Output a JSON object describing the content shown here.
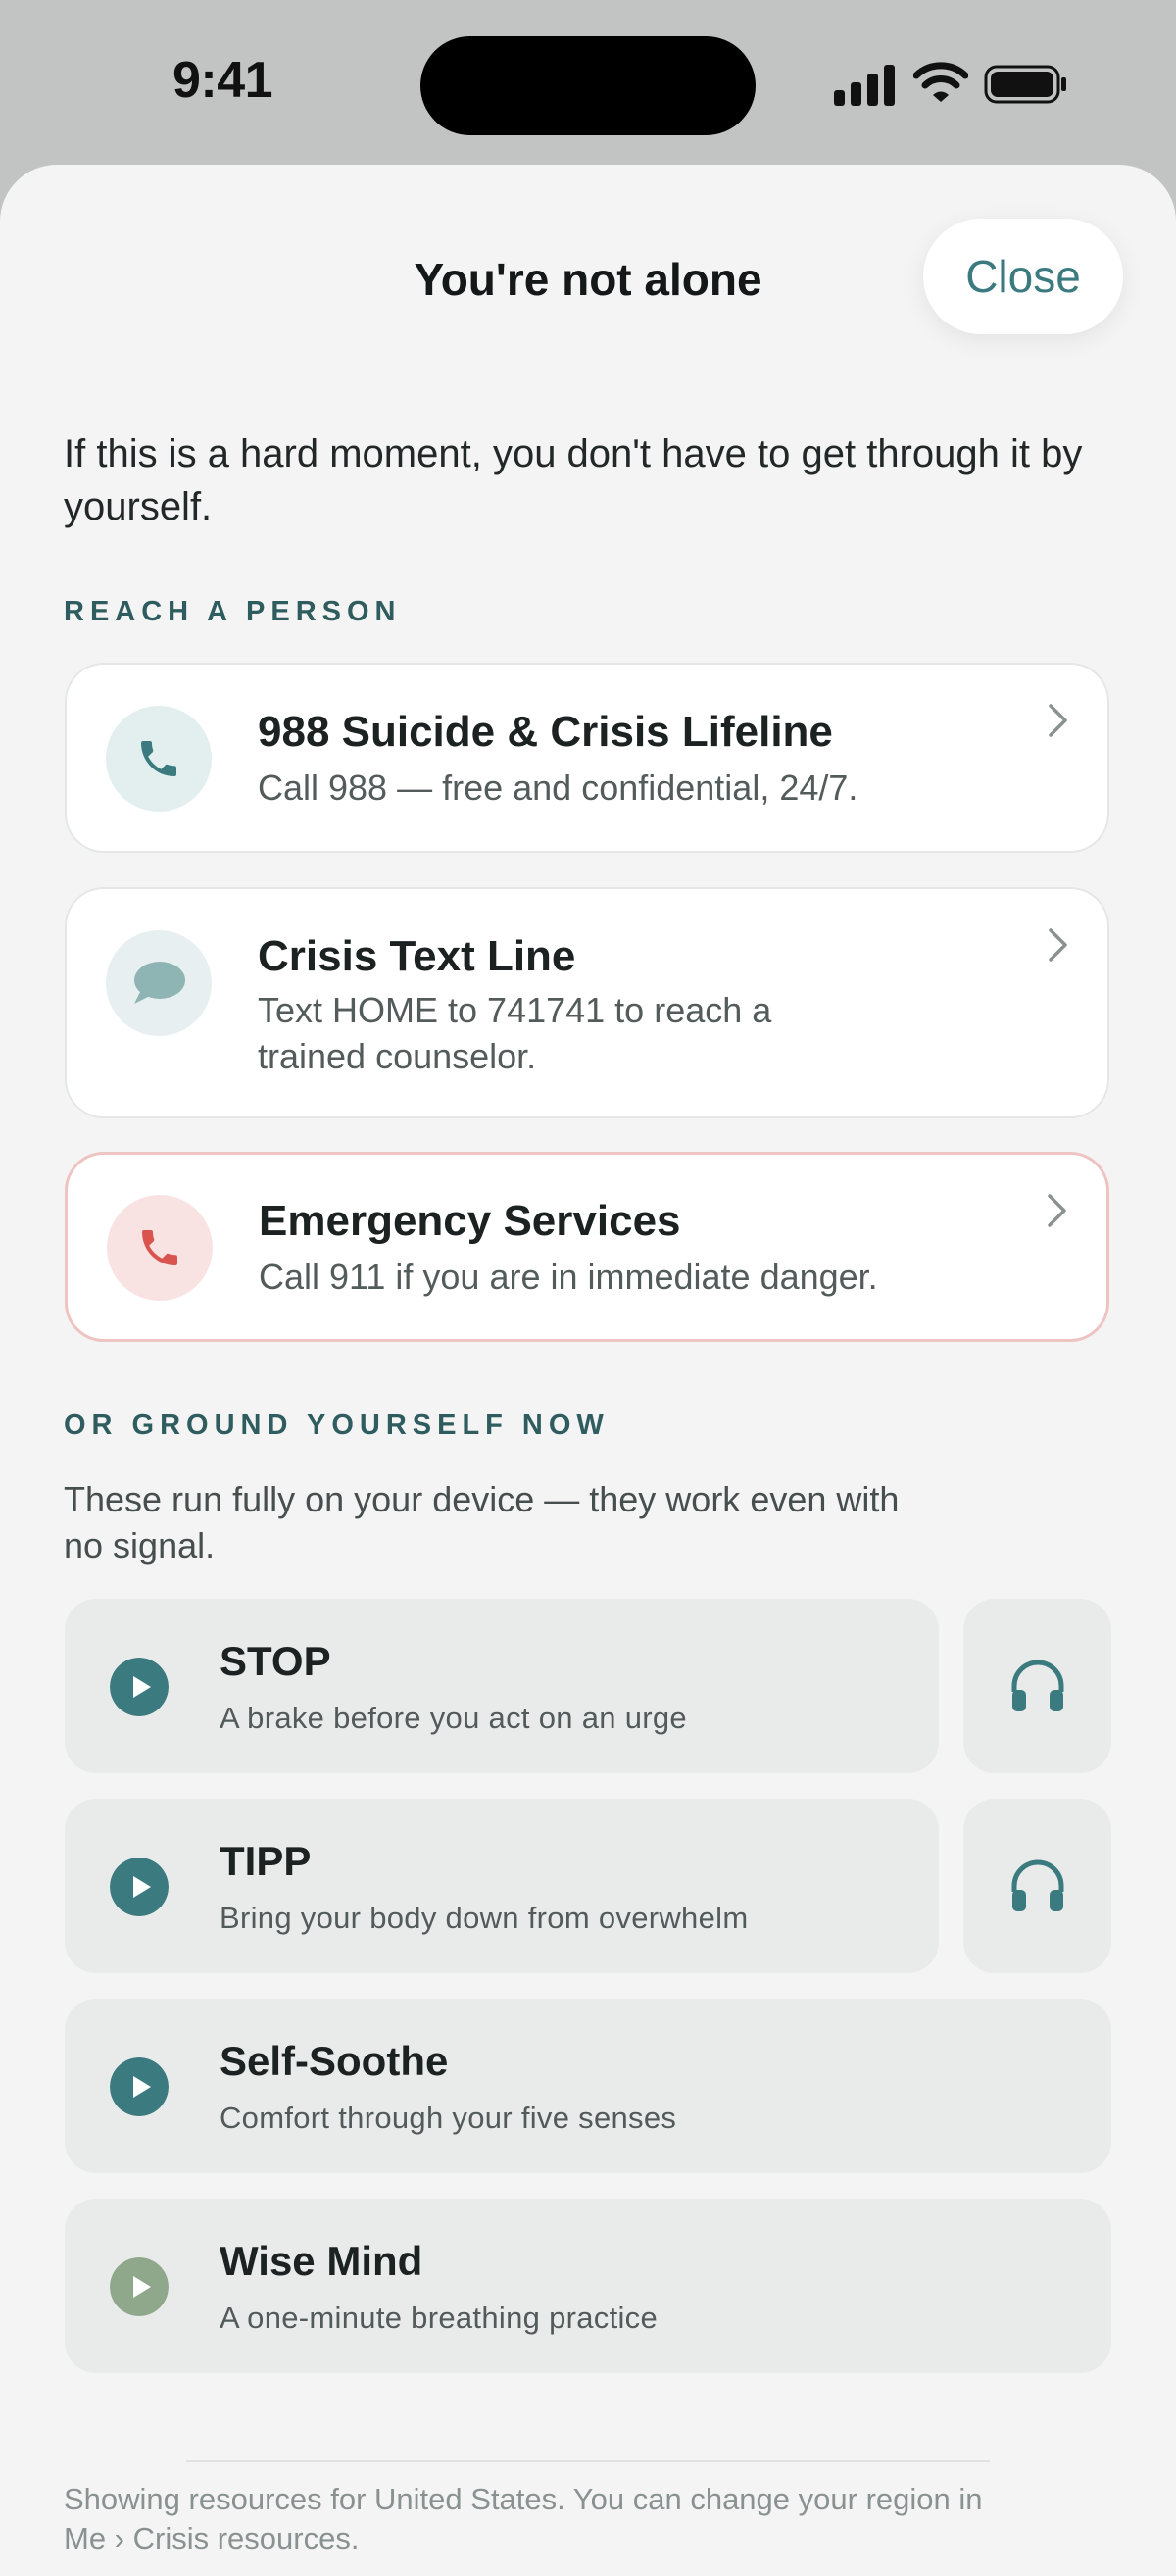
{
  "status": {
    "time": "9:41"
  },
  "sheet": {
    "title": "You're not alone",
    "close_label": "Close"
  },
  "intro": "If this is a hard moment, you don't have to get through it by yourself.",
  "reach": {
    "label": "REACH A PERSON",
    "cards": [
      {
        "title": "988 Suicide & Crisis Lifeline",
        "subtitle": "Call 988 — free and confidential, 24/7.",
        "icon": "phone-icon"
      },
      {
        "title": "Crisis Text Line",
        "subtitle_line1": "Text HOME to 741741 to reach a",
        "subtitle_line2": "trained counselor.",
        "icon": "message-icon"
      },
      {
        "title": "Emergency Services",
        "subtitle": "Call 911 if you are in immediate danger.",
        "icon": "emergency-phone-icon"
      }
    ]
  },
  "ground": {
    "label": "OR GROUND YOURSELF NOW",
    "note_line1": "These run fully on your device — they work even with",
    "note_line2": "no signal.",
    "tools": [
      {
        "title": "STOP",
        "subtitle": "A brake before you act on an urge",
        "has_audio": true
      },
      {
        "title": "TIPP",
        "subtitle": "Bring your body down from overwhelm",
        "has_audio": true
      },
      {
        "title": "Self-Soothe",
        "subtitle": "Comfort through your five senses",
        "has_audio": false
      },
      {
        "title": "Wise Mind",
        "subtitle": "A one-minute breathing practice",
        "has_audio": false
      }
    ]
  },
  "footer": {
    "line1": "Showing resources for United States. You can change your region in",
    "line2": "Me › Crisis resources."
  },
  "colors": {
    "accent": "#3b7b80",
    "danger": "#d9544f",
    "sage": "#8fa88c",
    "background": "#f3f4f3"
  }
}
